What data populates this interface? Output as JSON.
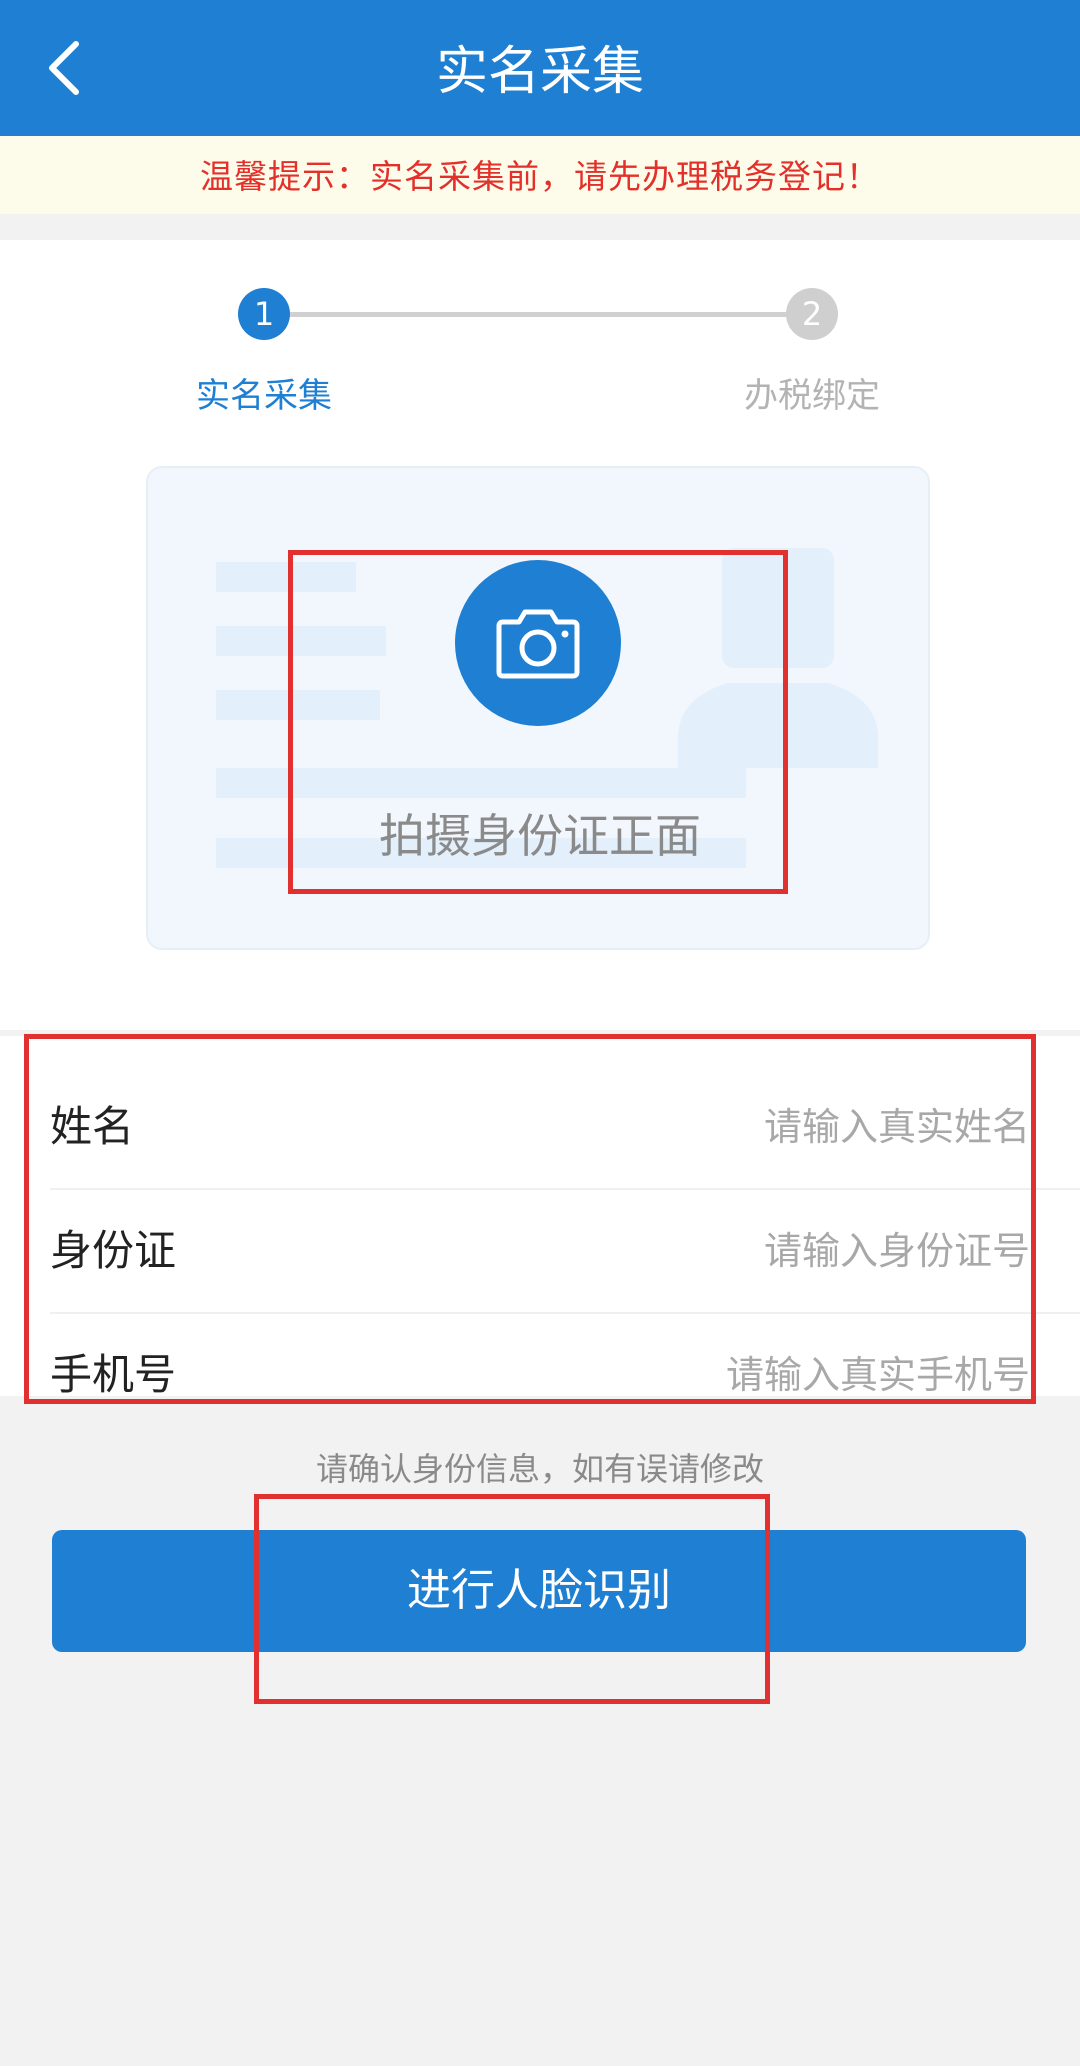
{
  "header": {
    "title": "实名采集"
  },
  "notice": {
    "text": "温馨提示：实名采集前，请先办理税务登记！"
  },
  "steps": [
    {
      "number": "1",
      "label": "实名采集"
    },
    {
      "number": "2",
      "label": "办税绑定"
    }
  ],
  "capture": {
    "label": "拍摄身份证正面"
  },
  "form": {
    "rows": [
      {
        "label": "姓名",
        "placeholder": "请输入真实姓名"
      },
      {
        "label": "身份证",
        "placeholder": "请输入身份证号"
      },
      {
        "label": "手机号",
        "placeholder": "请输入真实手机号"
      }
    ]
  },
  "hint": "请确认身份信息，如有误请修改",
  "button": {
    "label": "进行人脸识别"
  },
  "colors": {
    "primary": "#1e7fd3",
    "notice_text": "#e3302a",
    "annotation": "#e0302f"
  },
  "icons": [
    "back-arrow-icon",
    "camera-icon",
    "portrait-silhouette-icon"
  ]
}
